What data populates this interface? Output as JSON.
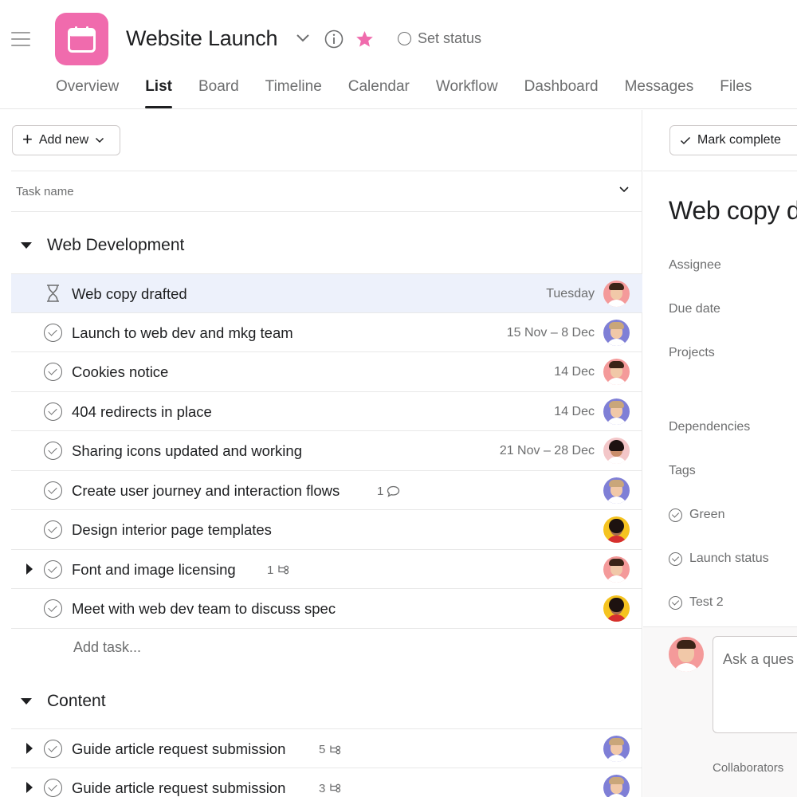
{
  "header": {
    "project_title": "Website Launch",
    "set_status": "Set status",
    "icon_color": "#f06bad",
    "star_color": "#f06bad"
  },
  "tabs": [
    {
      "label": "Overview",
      "active": false
    },
    {
      "label": "List",
      "active": true
    },
    {
      "label": "Board",
      "active": false
    },
    {
      "label": "Timeline",
      "active": false
    },
    {
      "label": "Calendar",
      "active": false
    },
    {
      "label": "Workflow",
      "active": false
    },
    {
      "label": "Dashboard",
      "active": false
    },
    {
      "label": "Messages",
      "active": false
    },
    {
      "label": "Files",
      "active": false
    }
  ],
  "toolbar": {
    "add_new": "Add new"
  },
  "list": {
    "column_header": "Task name",
    "add_task": "Add task...",
    "sections": [
      {
        "name": "Web Development",
        "tasks": [
          {
            "name": "Web copy drafted",
            "date": "Tuesday",
            "icon": "hourglass-icon",
            "avatar": "pink"
          },
          {
            "name": "Launch to web dev and mkg team",
            "date": "15 Nov – 8 Dec",
            "icon": "check-circle-icon",
            "avatar": "purple"
          },
          {
            "name": "Cookies notice",
            "date": "14 Dec",
            "icon": "check-circle-icon",
            "avatar": "pink"
          },
          {
            "name": "404 redirects in place",
            "date": "14 Dec",
            "icon": "check-circle-icon",
            "avatar": "purple"
          },
          {
            "name": "Sharing icons updated and working",
            "date": "21 Nov – 28 Dec",
            "icon": "check-circle-icon",
            "avatar": "rose"
          },
          {
            "name": "Create user journey and interaction flows",
            "comments": "1",
            "icon": "check-circle-icon",
            "avatar": "purple"
          },
          {
            "name": "Design interior page templates",
            "icon": "check-circle-icon",
            "avatar": "yellow"
          },
          {
            "name": "Font and image licensing",
            "subtasks": "1",
            "icon": "check-circle-icon",
            "avatar": "pink",
            "expandable": true
          },
          {
            "name": "Meet with web dev team to discuss spec",
            "icon": "check-circle-icon",
            "avatar": "yellow"
          }
        ]
      },
      {
        "name": "Content",
        "tasks": [
          {
            "name": "Guide article request submission",
            "subtasks": "5",
            "icon": "check-circle-icon",
            "avatar": "purple",
            "expandable": true
          },
          {
            "name": "Guide article request submission",
            "subtasks": "3",
            "icon": "check-circle-icon",
            "avatar": "purple",
            "expandable": true
          }
        ]
      }
    ]
  },
  "detail": {
    "mark_complete": "Mark complete",
    "title": "Web copy d",
    "fields": [
      "Assignee",
      "Due date",
      "Projects",
      "Dependencies",
      "Tags"
    ],
    "custom_fields": [
      "Green",
      "Launch status",
      "Test 2"
    ],
    "comment_placeholder": "Ask a ques",
    "collaborators": "Collaborators"
  }
}
